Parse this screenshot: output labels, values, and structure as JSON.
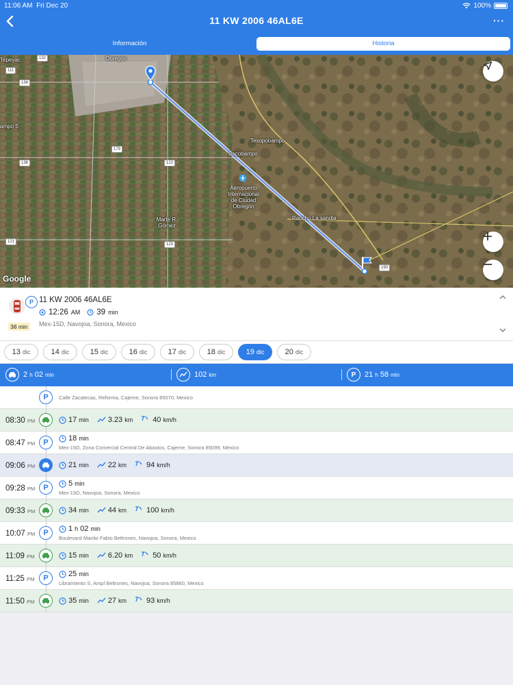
{
  "status_bar": {
    "time": "11:06 AM",
    "date": "Fri Dec 20",
    "battery": "100%"
  },
  "header": {
    "title": "11 KW 2006 46AL6E",
    "more": "···"
  },
  "tabs": [
    {
      "label": "Información",
      "active": false
    },
    {
      "label": "Historia",
      "active": true
    }
  ],
  "map": {
    "labels": {
      "obregon": "Obregón",
      "tepeyac": "Tepeyac",
      "campo5": "ampo 5",
      "tesopobampo": "Tesopobampo",
      "bacobampo": "Bacobampo",
      "airport": "Aeropuerto Internacional de Ciudad Obregón",
      "marte": "Marte R. Gómez",
      "rancho": "Rancho La sandia"
    },
    "shields": [
      "132",
      "111",
      "134",
      "136",
      "179",
      "123",
      "121",
      "123",
      "190"
    ],
    "google": "Google"
  },
  "info": {
    "vehicle_name": "11 KW 2006 46AL6E",
    "parking_badge": "P",
    "duration_badge": "38 min",
    "start_time": "12:26",
    "start_time_suffix": "AM",
    "elapsed": "39",
    "elapsed_unit": "min",
    "address": "Mex-15D, Navojoa, Sonora, Mexico"
  },
  "days": [
    {
      "num": "13",
      "unit": "dic",
      "active": false
    },
    {
      "num": "14",
      "unit": "dic",
      "active": false
    },
    {
      "num": "15",
      "unit": "dic",
      "active": false
    },
    {
      "num": "16",
      "unit": "dic",
      "active": false
    },
    {
      "num": "17",
      "unit": "dic",
      "active": false
    },
    {
      "num": "18",
      "unit": "dic",
      "active": false
    },
    {
      "num": "19",
      "unit": "dic",
      "active": true
    },
    {
      "num": "20",
      "unit": "dic",
      "active": false
    }
  ],
  "summary": {
    "drive_hours": "2",
    "h": "h",
    "drive_minutes": "02",
    "min": "min",
    "distance": "102",
    "km": "km",
    "park_hours": "21",
    "park_minutes": "58",
    "p": "P"
  },
  "timeline": [
    {
      "type": "park",
      "time": "",
      "ampm": "",
      "dur_h": "",
      "dur_m": "",
      "address": "Calle Zacatecas, Reforma, Cajeme, Sonora 85070, Mexico"
    },
    {
      "type": "drive",
      "time": "08:30",
      "ampm": "PM",
      "mins": "17",
      "km": "3.23",
      "max": "40"
    },
    {
      "type": "park",
      "time": "08:47",
      "ampm": "PM",
      "dur_h": "",
      "dur_m": "18",
      "address": "Mex-15D, Zona Comercial Central De Abastos, Cajeme, Sonora 85099, Mexico"
    },
    {
      "type": "drive",
      "highlight": true,
      "time": "09:06",
      "ampm": "PM",
      "mins": "21",
      "km": "22",
      "max": "94"
    },
    {
      "type": "park",
      "time": "09:28",
      "ampm": "PM",
      "dur_h": "",
      "dur_m": "5",
      "address": "Mex-15D, Navojoa, Sonora, Mexico"
    },
    {
      "type": "drive",
      "time": "09:33",
      "ampm": "PM",
      "mins": "34",
      "km": "44",
      "max": "100"
    },
    {
      "type": "park",
      "time": "10:07",
      "ampm": "PM",
      "dur_h": "1",
      "dur_m": "02",
      "address": "Boulevard Manlio Fabio Beltrones, Navojoa, Sonora, Mexico"
    },
    {
      "type": "drive",
      "time": "11:09",
      "ampm": "PM",
      "mins": "15",
      "km": "6.20",
      "max": "50"
    },
    {
      "type": "park",
      "time": "11:25",
      "ampm": "PM",
      "dur_h": "",
      "dur_m": "25",
      "address": "Libramiento S, Ampl Beltrones, Navojoa, Sonora 85860, Mexico"
    },
    {
      "type": "drive",
      "time": "11:50",
      "ampm": "PM",
      "mins": "35",
      "km": "27",
      "max": "93"
    }
  ],
  "units": {
    "min": "min",
    "km": "km",
    "kmh": "km/h",
    "h": "h",
    "max": "max"
  },
  "colors": {
    "primary": "#2f7ee6",
    "green": "#3fa04c",
    "drive_row": "#e6f1e7",
    "highlight_row": "#e4e9f3"
  }
}
